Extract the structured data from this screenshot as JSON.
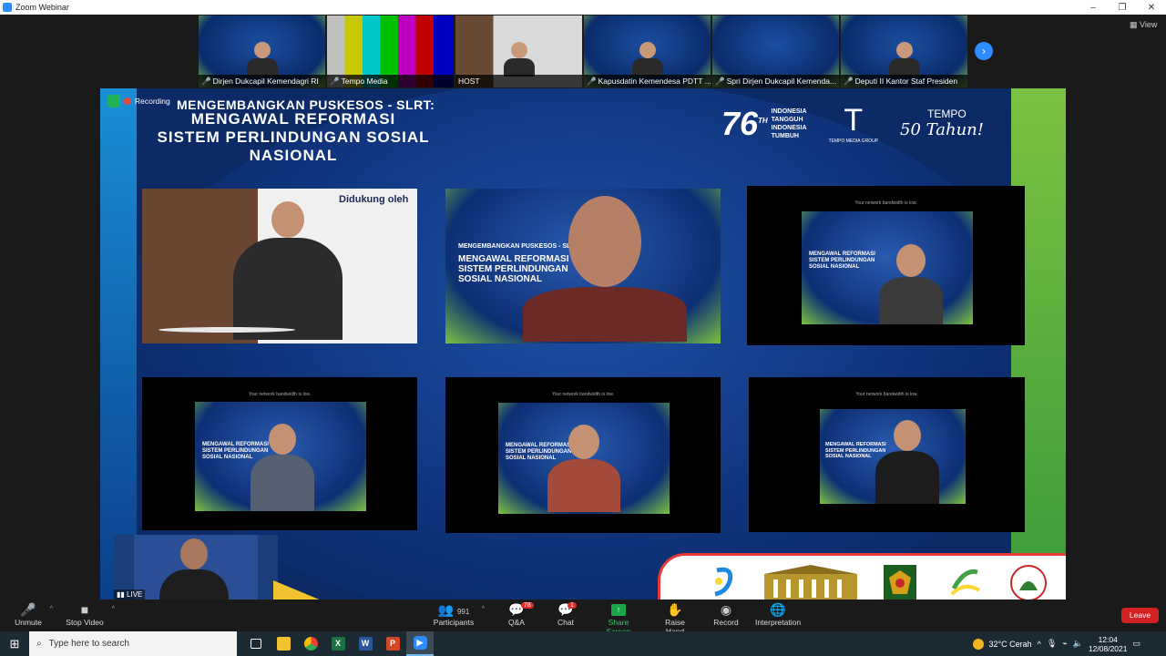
{
  "window": {
    "title": "Zoom Webinar",
    "controls": [
      "–",
      "❐",
      "✕"
    ]
  },
  "thumbnails": [
    {
      "name": "Dirjen Dukcapil Kemendagri RI",
      "kind": "slide"
    },
    {
      "name": "Tempo Media",
      "kind": "bars"
    },
    {
      "name": "HOST",
      "kind": "studio"
    },
    {
      "name": "Kapusdatin Kemendesa PDTT ...",
      "kind": "slide"
    },
    {
      "name": "Spri Dirjen Dukcapil Kemenda...",
      "kind": "slide"
    },
    {
      "name": "Deputi II Kantor Staf Presiden",
      "kind": "slide"
    }
  ],
  "view_label": "View",
  "next_icon": "chevron-right-icon",
  "stage": {
    "recording_label": "Recording",
    "title_line1": "MENGEMBANGKAN PUSKESOS - SLRT:",
    "title_line2": "MENGAWAL REFORMASI",
    "title_line3": "SISTEM PERLINDUNGAN SOSIAL NASIONAL",
    "logo76": {
      "number": "76",
      "sup": "TH",
      "lines": [
        "INDONESIA",
        "TANGGUH",
        "INDONESIA",
        "TUMBUH"
      ]
    },
    "logoT": {
      "letter": "T",
      "caption": "TEMPO MEDIA GROUP"
    },
    "logo50": {
      "top": "TEMPO",
      "sig": "50 Tahun!"
    },
    "studio_banner": "Didukung oleh",
    "tile_slide_text": [
      "MENGEMBANGKAN PUSKESOS - SLRT:",
      "MENGAWAL REFORMASI",
      "SISTEM PERLINDUNGAN",
      "SOSIAL NASIONAL"
    ],
    "bandwidth_note": "Your network bandwidth is low.",
    "live_label": "LIVE"
  },
  "controls": {
    "unmute": "Unmute",
    "stop_video": "Stop Video",
    "participants": "Participants",
    "participants_count": "991",
    "qa": "Q&A",
    "qa_badge": "78",
    "chat": "Chat",
    "chat_badge": "1",
    "share": "Share Screen",
    "raise_hand": "Raise Hand",
    "record": "Record",
    "interpretation": "Interpretation",
    "leave": "Leave"
  },
  "taskbar": {
    "search_placeholder": "Type here to search",
    "weather": "32°C  Cerah",
    "time": "12:04",
    "date": "12/08/2021"
  },
  "colors": {
    "zoom_blue": "#2d8cff",
    "stage_navy": "#0b2a66",
    "accent_green": "#7cc242",
    "leave_red": "#d32020"
  }
}
